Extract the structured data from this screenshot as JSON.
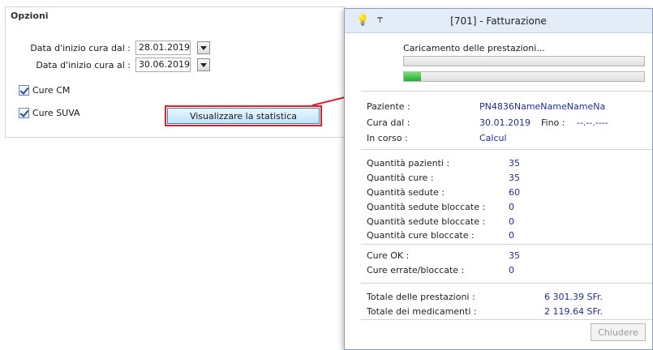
{
  "options": {
    "title": "Opzioni",
    "date_from_label": "Data d'inizio cura dal :",
    "date_from_value": "28.01.2019",
    "date_to_label": "Data d'inizio cura al :",
    "date_to_value": "30.06.2019",
    "cure_cm_label": "Cure CM",
    "cure_cm_checked": true,
    "cure_suva_label": "Cure SUVA",
    "cure_suva_checked": true,
    "stat_button_label": "Visualizzare la statistica"
  },
  "dialog": {
    "title": "[701] - Fatturazione",
    "loading_text": "Caricamento delle prestazioni...",
    "progress_primary": 0,
    "progress_secondary": 0.07,
    "patient_label": "Paziente :",
    "patient_value": "PN4836NameNameNameNa",
    "cura_dal_label": "Cura dal :",
    "cura_dal_value": "30.01.2019",
    "fino_label": "Fino :",
    "fino_value": "--.--.----",
    "in_corso_label": "In corso :",
    "in_corso_value": "Calcul",
    "stats": [
      {
        "label": "Quantità pazienti :",
        "value": "35"
      },
      {
        "label": "Quantità cure :",
        "value": "35"
      },
      {
        "label": "Quantità sedute :",
        "value": "60"
      },
      {
        "label": "Quantità sedute bloccate :",
        "value": "0"
      },
      {
        "label": "Quantità sedute bloccate :",
        "value": "0"
      },
      {
        "label": "Quantità cure bloccate :",
        "value": "0"
      }
    ],
    "cure_ok_label": "Cure OK :",
    "cure_ok_value": "35",
    "cure_err_label": "Cure errate/bloccate :",
    "cure_err_value": "0",
    "totale_prestazioni_label": "Totale delle prestazioni :",
    "totale_prestazioni_value": "6 301.39 SFr.",
    "totale_medicamenti_label": "Totale dei medicamenti :",
    "totale_medicamenti_value": "2 119.64 SFr.",
    "close_label": "Chiudere"
  },
  "colors": {
    "accent_red": "#d8202a",
    "value_blue": "#1f2e8c"
  }
}
